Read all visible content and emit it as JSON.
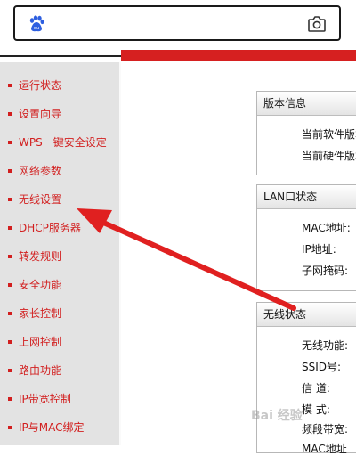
{
  "search": {
    "placeholder": ""
  },
  "sidebar": {
    "items": [
      {
        "label": "运行状态"
      },
      {
        "label": "设置向导"
      },
      {
        "label": "WPS一键安全设定"
      },
      {
        "label": "网络参数"
      },
      {
        "label": "无线设置"
      },
      {
        "label": "DHCP服务器"
      },
      {
        "label": "转发规则"
      },
      {
        "label": "安全功能"
      },
      {
        "label": "家长控制"
      },
      {
        "label": "上网控制"
      },
      {
        "label": "路由功能"
      },
      {
        "label": "IP带宽控制"
      },
      {
        "label": "IP与MAC绑定"
      }
    ]
  },
  "panels": {
    "version": {
      "title": "版本信息",
      "rows": [
        "当前软件版本",
        "当前硬件版本"
      ]
    },
    "lan": {
      "title": "LAN口状态",
      "rows": [
        "MAC地址:",
        "IP地址:",
        "子网掩码:"
      ]
    },
    "wireless": {
      "title": "无线状态",
      "rows": [
        "无线功能:",
        "SSID号:",
        "信 道:",
        "模 式:",
        "频段带宽:",
        "MAC地址"
      ]
    }
  },
  "watermark": "Bai 经验",
  "colors": {
    "menu_text": "#d21f1f",
    "header_red": "#d62020",
    "arrow": "#e02020",
    "sidebar_bg": "#e3e3e3"
  },
  "icons": {
    "search_logo": "baidu-paw-icon",
    "camera": "camera-icon"
  }
}
